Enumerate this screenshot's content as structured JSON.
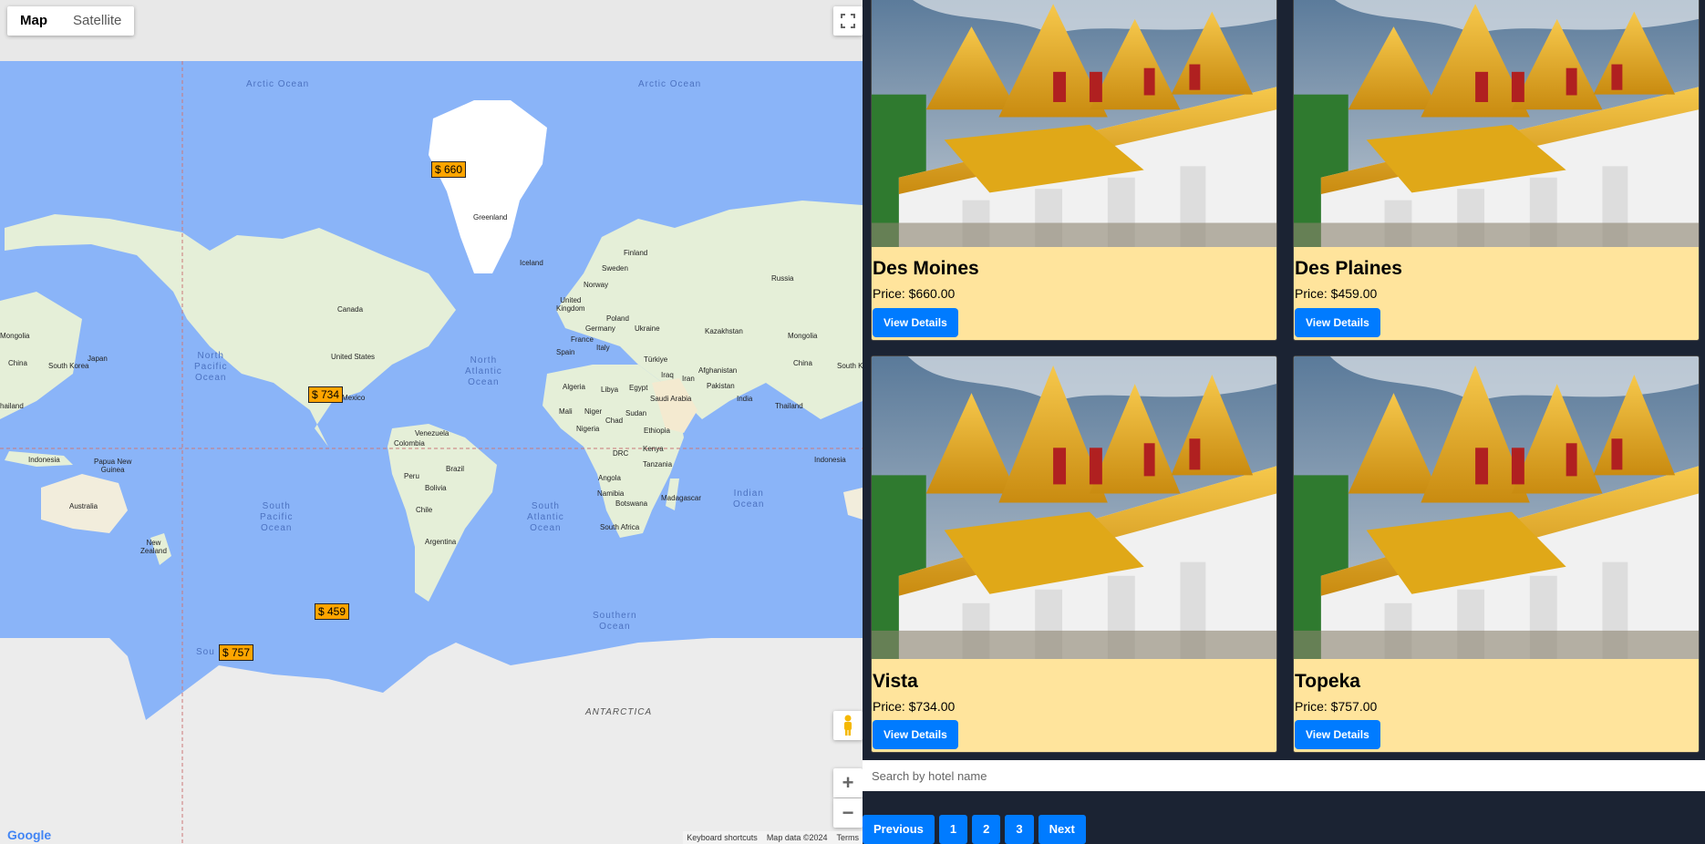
{
  "map": {
    "map_type_options": [
      "Map",
      "Satellite"
    ],
    "active_map_type": "Map",
    "markers": [
      "$ 660",
      "$ 734",
      "$ 459",
      "$ 757"
    ],
    "oceans": {
      "arctic1": "Arctic Ocean",
      "arctic2": "Arctic Ocean",
      "npacific": "North\nPacific\nOcean",
      "natlantic": "North\nAtlantic\nOcean",
      "spacific": "South\nPacific\nOcean",
      "satlantic": "South\nAtlantic\nOcean",
      "indian": "Indian\nOcean",
      "southern": "Southern\nOcean",
      "southern_partial": "Sou",
      "antarctica": "ANTARCTICA"
    },
    "countries": {
      "greenland": "Greenland",
      "iceland": "Iceland",
      "russia": "Russia",
      "canada": "Canada",
      "us": "United States",
      "mexico": "Mexico",
      "finland": "Finland",
      "sweden": "Sweden",
      "norway": "Norway",
      "uk": "United\nKingdom",
      "poland": "Poland",
      "germany": "Germany",
      "ukraine": "Ukraine",
      "france": "France",
      "spain": "Spain",
      "italy": "Italy",
      "turkiye": "Türkiye",
      "kazakhstan": "Kazakhstan",
      "mongolia_r": "Mongolia",
      "mongolia_l": "Mongolia",
      "china_r": "China",
      "china_l": "China",
      "japan": "Japan",
      "south_korea": "South Korea",
      "south_korea_r": "South Kore",
      "iraq": "Iraq",
      "iran": "Iran",
      "afghanistan": "Afghanistan",
      "pakistan": "Pakistan",
      "india": "India",
      "thailand_r": "Thailand",
      "thailand_l": "hailand",
      "algeria": "Algeria",
      "libya": "Libya",
      "egypt": "Egypt",
      "saudi": "Saudi Arabia",
      "mali": "Mali",
      "niger": "Niger",
      "chad": "Chad",
      "sudan": "Sudan",
      "nigeria": "Nigeria",
      "ethiopia": "Ethiopia",
      "drc": "DRC",
      "kenya": "Kenya",
      "tanzania": "Tanzania",
      "angola": "Angola",
      "namibia": "Namibia",
      "botswana": "Botswana",
      "madagascar": "Madagascar",
      "south_africa": "South Africa",
      "venezuela": "Venezuela",
      "colombia": "Colombia",
      "peru": "Peru",
      "brazil": "Brazil",
      "bolivia": "Bolivia",
      "chile": "Chile",
      "argentina": "Argentina",
      "indonesia_l": "Indonesia",
      "indonesia_r": "Indonesia",
      "png": "Papua New\nGuinea",
      "australia": "Australia",
      "nz": "New\nZealand"
    },
    "attribution": [
      "Keyboard shortcuts",
      "Map data ©2024",
      "Terms"
    ],
    "logo": "Google",
    "zoom_in": "+",
    "zoom_out": "−"
  },
  "hotels": [
    {
      "name": "Des Moines",
      "price": "Price: $660.00",
      "button": "View Details"
    },
    {
      "name": "Des Plaines",
      "price": "Price: $459.00",
      "button": "View Details"
    },
    {
      "name": "Vista",
      "price": "Price: $734.00",
      "button": "View Details"
    },
    {
      "name": "Topeka",
      "price": "Price: $757.00",
      "button": "View Details"
    }
  ],
  "search": {
    "placeholder": "Search by hotel name"
  },
  "pagination": {
    "previous": "Previous",
    "pages": [
      "1",
      "2",
      "3"
    ],
    "next": "Next"
  },
  "colors": {
    "accent": "#007bff",
    "card_bg": "#ffe49c",
    "marker": "#ffa500",
    "page_bg": "#1b2333",
    "ocean": "#8ab4f8"
  }
}
